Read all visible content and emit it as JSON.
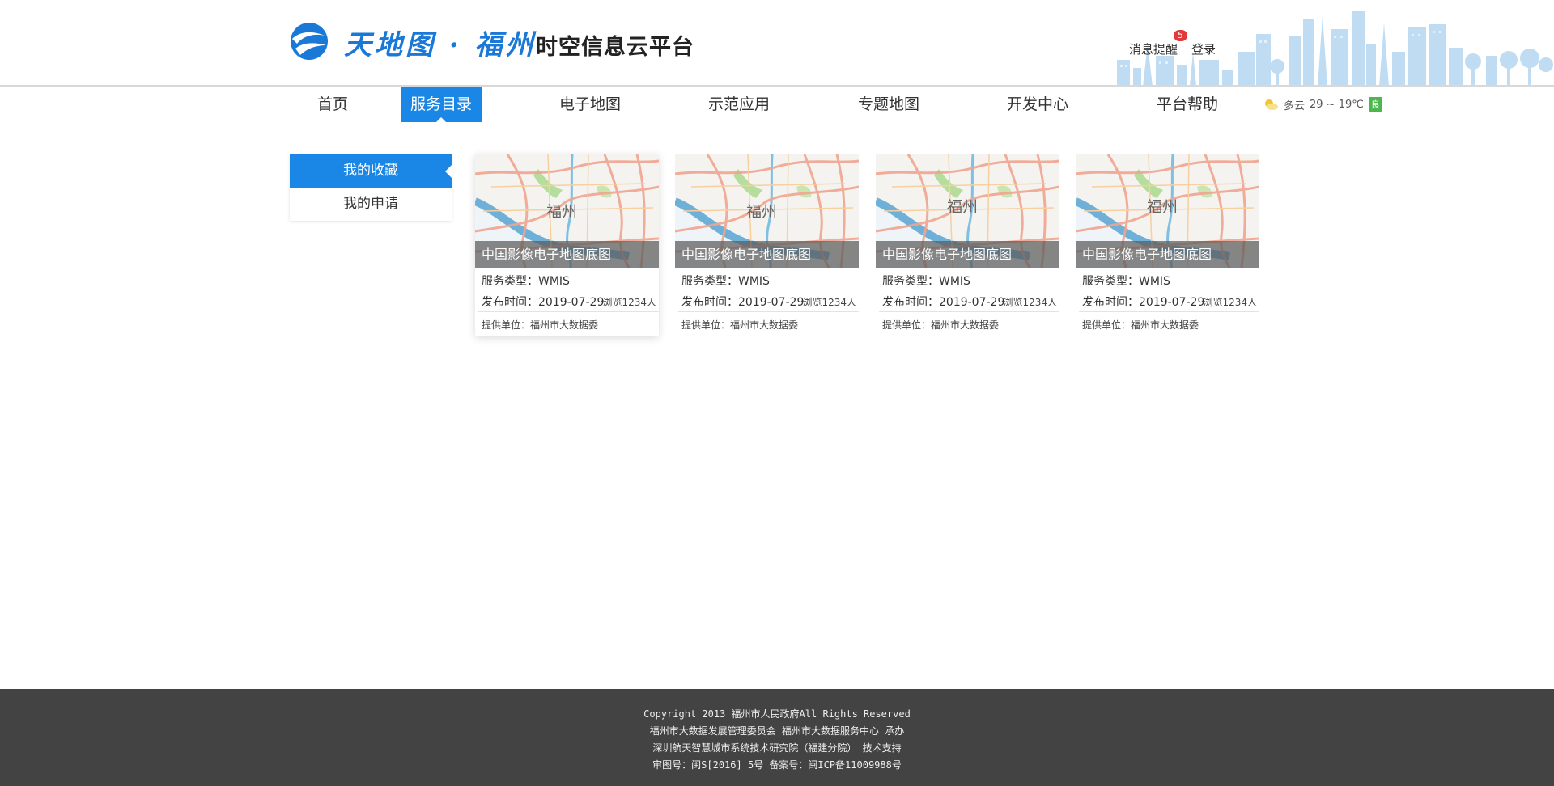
{
  "header": {
    "brand": "天地图 · 福州",
    "platform_title": "时空信息云平台",
    "message_label": "消息提醒",
    "message_count": "5",
    "login_label": "登录"
  },
  "nav": {
    "items": [
      {
        "label": "首页"
      },
      {
        "label": "服务目录",
        "active": true
      },
      {
        "label": "电子地图"
      },
      {
        "label": "示范应用"
      },
      {
        "label": "专题地图"
      },
      {
        "label": "开发中心"
      },
      {
        "label": "平台帮助"
      }
    ],
    "weather": {
      "icon": "partly-cloudy-icon",
      "condition": "多云",
      "temperature": "29 ~ 19℃",
      "air_quality": "良"
    }
  },
  "sidebar": {
    "items": [
      {
        "label": "我的收藏",
        "active": true
      },
      {
        "label": "我的申请"
      }
    ]
  },
  "cards": [
    {
      "city": "福州",
      "title": "中国影像电子地图底图",
      "type": "服务类型：WMIS",
      "date": "发布时间：2019-07-29",
      "views": "浏览1234人",
      "unit": "提供单位：福州市大数据委"
    },
    {
      "city": "福州",
      "title": "中国影像电子地图底图",
      "type": "服务类型：WMIS",
      "date": "发布时间：2019-07-29",
      "views": "浏览1234人",
      "unit": "提供单位：福州市大数据委"
    },
    {
      "city": "福州",
      "title": "中国影像电子地图底图",
      "type": "服务类型：WMIS",
      "date": "发布时间：2019-07-29",
      "views": "浏览1234人",
      "unit": "提供单位：福州市大数据委"
    },
    {
      "city": "福州",
      "title": "中国影像电子地图底图",
      "type": "服务类型：WMIS",
      "date": "发布时间：2019-07-29",
      "views": "浏览1234人",
      "unit": "提供单位：福州市大数据委"
    }
  ],
  "footer": {
    "lines": [
      "Copyright 2013 福州市人民政府All Rights Reserved",
      "福州市大数据发展管理委员会 福州市大数据服务中心 承办",
      "深圳航天智慧城市系统技术研究院（福建分院） 技术支持",
      "审图号：闽S[2016] 5号 备案号：闽ICP备11009988号"
    ]
  },
  "colors": {
    "accent": "#1a87e6",
    "badge": "#e23a3a",
    "footer_bg": "#434343",
    "air_quality": "#4cb84c"
  }
}
